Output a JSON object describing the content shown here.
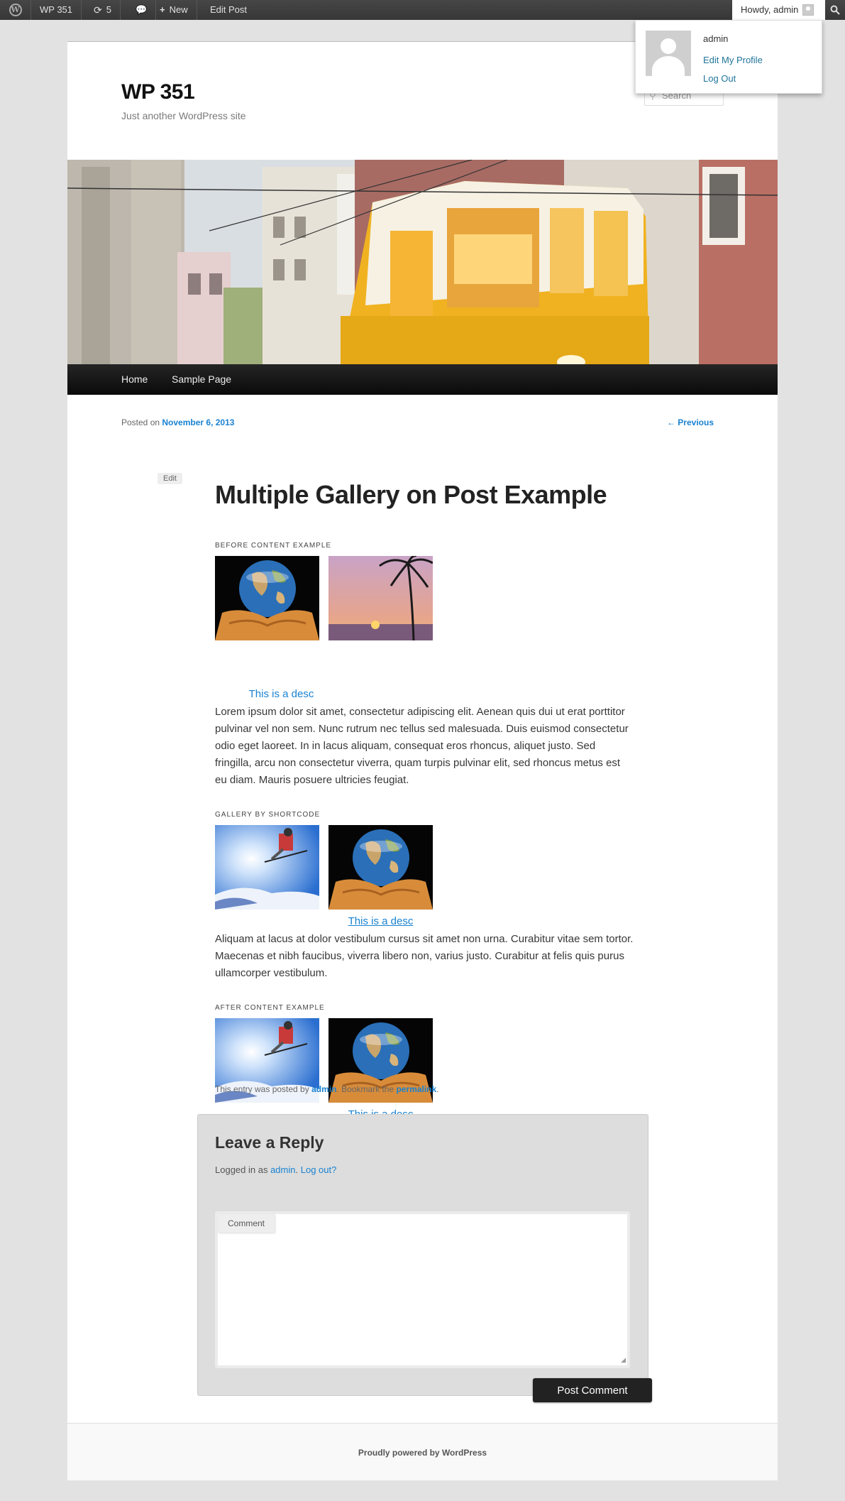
{
  "admin_bar": {
    "site_name": "WP 351",
    "updates_count": "5",
    "new_label": "New",
    "edit_post_label": "Edit Post",
    "howdy": "Howdy, admin",
    "user_menu": {
      "name": "admin",
      "edit_profile": "Edit My Profile",
      "log_out": "Log Out"
    }
  },
  "site": {
    "title": "WP 351",
    "description": "Just another WordPress site",
    "search_placeholder": "Search"
  },
  "nav": {
    "items": [
      "Home",
      "Sample Page"
    ]
  },
  "post": {
    "posted_on_label": "Posted on",
    "date": "November 6, 2013",
    "previous_link": "← Previous",
    "edit_label": "Edit",
    "title": "Multiple Gallery on Post Example",
    "galleries": [
      {
        "title": "BEFORE CONTENT EXAMPLE",
        "caption": "This is a desc"
      },
      {
        "title": "GALLERY BY SHORTCODE",
        "caption": "This is a desc"
      },
      {
        "title": "AFTER CONTENT EXAMPLE",
        "caption": "This is a desc"
      }
    ],
    "paragraphs": [
      "Lorem ipsum dolor sit amet, consectetur adipiscing elit. Aenean quis dui ut erat porttitor pulvinar vel non sem. Nunc rutrum nec tellus sed malesuada. Duis euismod consectetur odio eget laoreet. In in lacus aliquam, consequat eros rhoncus, aliquet justo. Sed fringilla, arcu non consectetur viverra, quam turpis pulvinar elit, sed rhoncus metus est eu diam. Mauris posuere ultricies feugiat.",
      "Aliquam at lacus at dolor vestibulum cursus sit amet non urna. Curabitur vitae sem tortor. Maecenas et nibh faucibus, viverra libero non, varius justo. Curabitur at felis quis purus ullamcorper vestibulum."
    ],
    "entry_meta": {
      "prefix": "This entry was posted by",
      "author": "admin",
      "middle": ". Bookmark the",
      "permalink": "permalink",
      "suffix": "."
    }
  },
  "comments": {
    "reply_title": "Leave a Reply",
    "logged_in_prefix": "Logged in as",
    "logged_in_user": "admin",
    "log_out": "Log out?",
    "comment_label": "Comment",
    "submit_label": "Post Comment"
  },
  "footer": {
    "text": "Proudly powered by WordPress"
  },
  "colors": {
    "link": "#1982d1",
    "admin_bar": "#464646",
    "page_bg": "#e2e2e2"
  }
}
